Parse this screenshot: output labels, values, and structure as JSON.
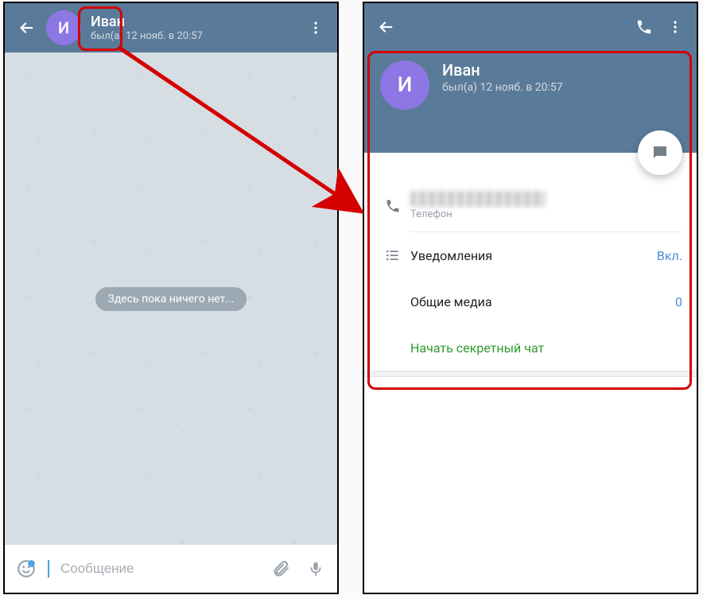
{
  "chat": {
    "avatar_letter": "И",
    "name": "Иван",
    "status": "был(а) 12 нояб. в 20:57",
    "empty_text": "Здесь пока ничего нет...",
    "input_placeholder": "Сообщение"
  },
  "profile": {
    "avatar_letter": "И",
    "name": "Иван",
    "status": "был(а) 12 нояб. в 20:57",
    "phone_label": "Телефон",
    "notifications_label": "Уведомления",
    "notifications_value": "Вкл.",
    "shared_media_label": "Общие медиа",
    "shared_media_value": "0",
    "secret_chat_label": "Начать секретный чат"
  }
}
